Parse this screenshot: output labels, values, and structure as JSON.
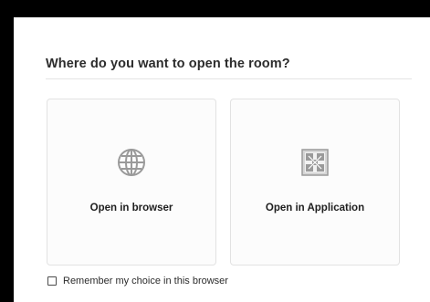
{
  "dialog": {
    "title": "Where do you want to open the room?"
  },
  "options": [
    {
      "label": "Open in browser",
      "icon": "globe-icon"
    },
    {
      "label": "Open in Application",
      "icon": "application-icon"
    }
  ],
  "remember": {
    "label": "Remember my choice in this browser",
    "checked": false
  },
  "colors": {
    "backdrop": "#000000",
    "icon": "#9a9a9a",
    "card_border": "#e2e2e2"
  }
}
